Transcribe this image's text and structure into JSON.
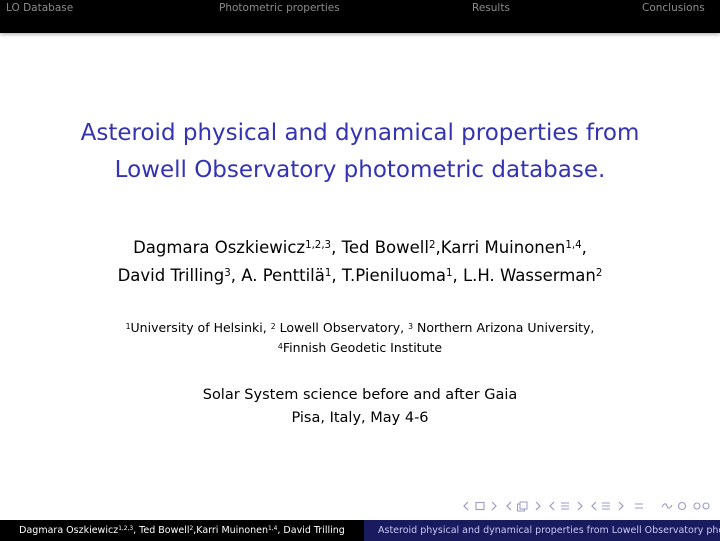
{
  "nav": {
    "sections": [
      "LO Database",
      "Photometric properties",
      "Results",
      "Conclusions"
    ]
  },
  "title": {
    "line1": "Asteroid physical and dynamical properties from",
    "line2": "Lowell Observatory photometric database."
  },
  "authors": {
    "line1": [
      {
        "name": "Dagmara Oszkiewicz",
        "sup": "1,2,3",
        "sep": ", "
      },
      {
        "name": "Ted Bowell",
        "sup": "2",
        "sep": ","
      },
      {
        "name": "Karri Muinonen",
        "sup": "1,4",
        "sep": ","
      }
    ],
    "line2": [
      {
        "name": "David Trilling",
        "sup": "3",
        "sep": ", "
      },
      {
        "name": "A. Penttilä",
        "sup": "1",
        "sep": ", "
      },
      {
        "name": "T.Pieniluoma",
        "sup": "1",
        "sep": ", "
      },
      {
        "name": "L.H. Wasserman",
        "sup": "2",
        "sep": ""
      }
    ]
  },
  "affiliations": {
    "a1_sup": "1",
    "a1": "University of Helsinki, ",
    "a2_sup": "2",
    "a2": " Lowell Observatory, ",
    "a3_sup": "3",
    "a3": " Northern Arizona University,",
    "a4_sup": "4",
    "a4": "Finnish Geodetic Institute"
  },
  "conference": {
    "line1": "Solar System science before and after Gaia",
    "line2": "Pisa, Italy, May 4-6"
  },
  "footer": {
    "left_a": "Dagmara Oszkiewicz",
    "left_a_sup": "1,2,3",
    "left_b": ", Ted Bowell",
    "left_b_sup": "2",
    "left_c": ",Karri Muinonen",
    "left_c_sup": "1,4",
    "left_d": ", David Trilling",
    "right": "Asteroid physical and dynamical properties from Lowell Observatory photometric database."
  },
  "colors": {
    "title": "#3333b3",
    "topbar": "#000000",
    "footer_right": "#1a1a5e"
  }
}
